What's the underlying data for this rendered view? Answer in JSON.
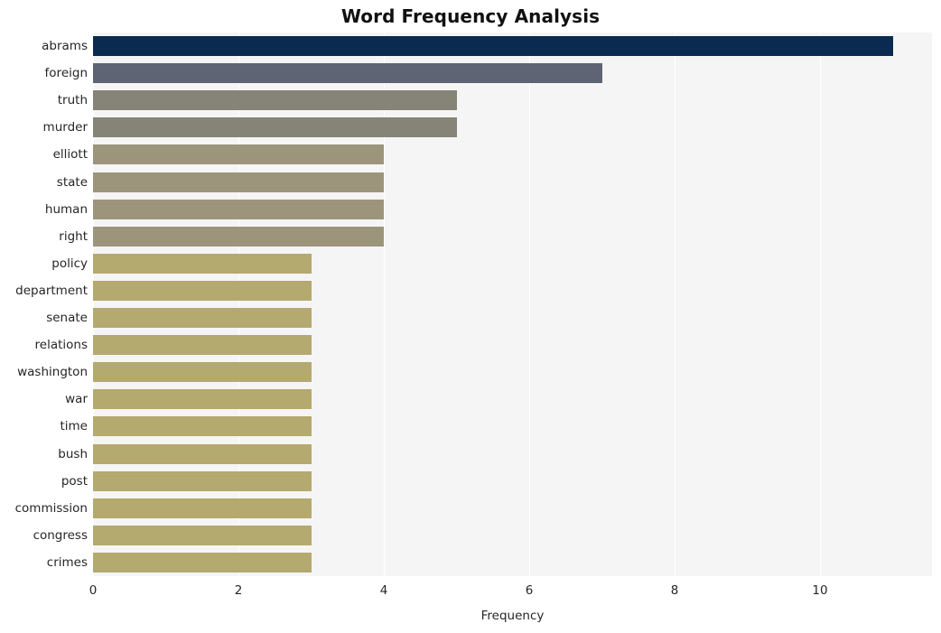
{
  "chart_data": {
    "type": "bar",
    "orientation": "horizontal",
    "title": "Word Frequency Analysis",
    "xlabel": "Frequency",
    "ylabel": "",
    "categories": [
      "abrams",
      "foreign",
      "truth",
      "murder",
      "elliott",
      "state",
      "human",
      "right",
      "policy",
      "department",
      "senate",
      "relations",
      "washington",
      "war",
      "time",
      "bush",
      "post",
      "commission",
      "congress",
      "crimes"
    ],
    "values": [
      11,
      7,
      5,
      5,
      4,
      4,
      4,
      4,
      3,
      3,
      3,
      3,
      3,
      3,
      3,
      3,
      3,
      3,
      3,
      3
    ],
    "bar_colors": [
      "#0a2a4f",
      "#5f6474",
      "#868477",
      "#868477",
      "#9c957c",
      "#9c957c",
      "#9c957c",
      "#9c957c",
      "#b4a96f",
      "#b4a96f",
      "#b4a96f",
      "#b4a96f",
      "#b4a96f",
      "#b4a96f",
      "#b4a96f",
      "#b4a96f",
      "#b4a96f",
      "#b4a96f",
      "#b4a96f",
      "#b4a96f"
    ],
    "xlim": [
      0,
      11.54
    ],
    "ylim_categories": 20,
    "xticks": [
      0,
      2,
      4,
      6,
      8,
      10
    ],
    "xtick_labels": [
      "0",
      "2",
      "4",
      "6",
      "8",
      "10"
    ],
    "grid": {
      "vertical": true,
      "horizontal": false,
      "color": "#ffffff"
    },
    "legend": null,
    "plot_background": "#f5f5f5",
    "figure_background": "#ffffff",
    "text_color": "#262626",
    "title_color": "#111111"
  }
}
